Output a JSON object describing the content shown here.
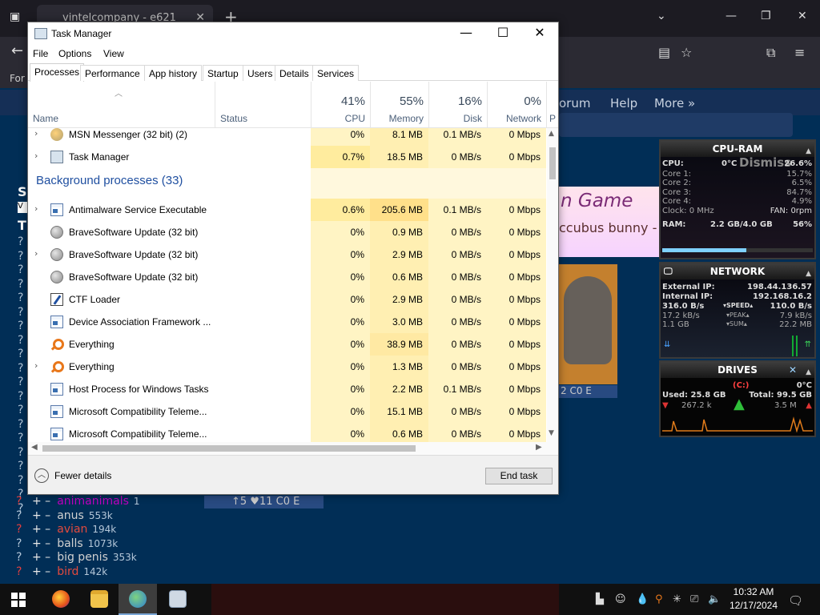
{
  "browser": {
    "tab_title": "vintelcompany - e621",
    "for_label": "For",
    "site_nav": [
      "orum",
      "Help",
      "More »"
    ],
    "game_title": "n Game",
    "game_subtitle": "ccubus bunny -",
    "post_stats": "2 C0 E",
    "post_stats2": "↑5 ♥11 C0 E",
    "left_letters": [
      "S",
      "V",
      "T",
      "?",
      "?",
      "?",
      "?",
      "?",
      "?",
      "?",
      "?",
      "?",
      "?",
      "?",
      "?",
      "?",
      "?",
      "?",
      "?",
      "?",
      "?",
      "?",
      "?"
    ],
    "tags": [
      {
        "q": "?",
        "pm": "+ –",
        "name": "animanimals",
        "count": "1",
        "color": "#c000c0"
      },
      {
        "q": "?",
        "pm": "+ –",
        "name": "anus",
        "count": "553k",
        "color": "#d0d0d0"
      },
      {
        "q": "?",
        "pm": "+ –",
        "name": "avian",
        "count": "194k",
        "color": "#e34a3d"
      },
      {
        "q": "?",
        "pm": "+ –",
        "name": "balls",
        "count": "1073k",
        "color": "#d0d0d0"
      },
      {
        "q": "?",
        "pm": "+ –",
        "name": "big penis",
        "count": "353k",
        "color": "#d0d0d0"
      },
      {
        "q": "?",
        "pm": "+ –",
        "name": "bird",
        "count": "142k",
        "color": "#e34a3d"
      }
    ]
  },
  "taskmanager": {
    "title": "Task Manager",
    "menu": [
      "File",
      "Options",
      "View"
    ],
    "tabs": [
      "Processes",
      "Performance",
      "App history",
      "Startup",
      "Users",
      "Details",
      "Services"
    ],
    "active_tab": "Processes",
    "columns": {
      "name": "Name",
      "status": "Status",
      "cpu": {
        "pct": "41%",
        "label": "CPU"
      },
      "memory": {
        "pct": "55%",
        "label": "Memory"
      },
      "disk": {
        "pct": "16%",
        "label": "Disk"
      },
      "network": {
        "pct": "0%",
        "label": "Network"
      },
      "power_partial": "P"
    },
    "rows": [
      {
        "expand": true,
        "icon": "msn-icon",
        "name": "MSN Messenger (32 bit) (2)",
        "cpu": "0%",
        "mem": "8.1 MB",
        "disk": "0.1 MB/s",
        "net": "0 Mbps"
      },
      {
        "expand": true,
        "icon": "task-manager-icon",
        "name": "Task Manager",
        "cpu": "0.7%",
        "mem": "18.5 MB",
        "disk": "0 MB/s",
        "net": "0 Mbps"
      },
      {
        "section": "Background processes (33)"
      },
      {
        "expand": true,
        "icon": "app-window-icon",
        "name": "Antimalware Service Executable",
        "cpu": "0.6%",
        "mem": "205.6 MB",
        "disk": "0.1 MB/s",
        "net": "0 Mbps"
      },
      {
        "expand": false,
        "icon": "globe-icon",
        "name": "BraveSoftware Update (32 bit)",
        "cpu": "0%",
        "mem": "0.9 MB",
        "disk": "0 MB/s",
        "net": "0 Mbps"
      },
      {
        "expand": true,
        "icon": "globe-icon",
        "name": "BraveSoftware Update (32 bit)",
        "cpu": "0%",
        "mem": "2.9 MB",
        "disk": "0 MB/s",
        "net": "0 Mbps"
      },
      {
        "expand": false,
        "icon": "globe-icon",
        "name": "BraveSoftware Update (32 bit)",
        "cpu": "0%",
        "mem": "0.6 MB",
        "disk": "0 MB/s",
        "net": "0 Mbps"
      },
      {
        "expand": false,
        "icon": "ctf-loader-icon",
        "name": "CTF Loader",
        "cpu": "0%",
        "mem": "2.9 MB",
        "disk": "0 MB/s",
        "net": "0 Mbps"
      },
      {
        "expand": false,
        "icon": "app-window-icon",
        "name": "Device Association Framework ...",
        "cpu": "0%",
        "mem": "3.0 MB",
        "disk": "0 MB/s",
        "net": "0 Mbps"
      },
      {
        "expand": false,
        "icon": "everything-search-icon",
        "name": "Everything",
        "cpu": "0%",
        "mem": "38.9 MB",
        "disk": "0 MB/s",
        "net": "0 Mbps"
      },
      {
        "expand": true,
        "icon": "everything-search-icon",
        "name": "Everything",
        "cpu": "0%",
        "mem": "1.3 MB",
        "disk": "0 MB/s",
        "net": "0 Mbps"
      },
      {
        "expand": false,
        "icon": "app-window-icon",
        "name": "Host Process for Windows Tasks",
        "cpu": "0%",
        "mem": "2.2 MB",
        "disk": "0.1 MB/s",
        "net": "0 Mbps"
      },
      {
        "expand": false,
        "icon": "app-window-icon",
        "name": "Microsoft Compatibility Teleme...",
        "cpu": "0%",
        "mem": "15.1 MB",
        "disk": "0 MB/s",
        "net": "0 Mbps"
      },
      {
        "expand": false,
        "icon": "app-window-icon",
        "name": "Microsoft Compatibility Teleme...",
        "cpu": "0%",
        "mem": "0.6 MB",
        "disk": "0 MB/s",
        "net": "0 Mbps"
      }
    ],
    "fewer_details": "Fewer details",
    "end_task": "End task"
  },
  "gadgets": {
    "cpu_ram": {
      "title": "CPU-RAM",
      "dismiss": "Dismiss",
      "cpu_label": "CPU:",
      "cpu_temp": "0°C",
      "cpu_value": "26.6%",
      "cores": [
        {
          "label": "Core 1:",
          "value": "15.7%"
        },
        {
          "label": "Core 2:",
          "value": "6.5%"
        },
        {
          "label": "Core 3:",
          "value": "84.7%"
        },
        {
          "label": "Core 4:",
          "value": "4.9%"
        }
      ],
      "clock": "Clock: 0 MHz",
      "fan": "FAN: 0rpm",
      "ram_label": "RAM:",
      "ram_used": "2.2 GB/4.0 GB",
      "ram_pct": "56%"
    },
    "network": {
      "title": "NETWORK",
      "external_label": "External IP:",
      "external_ip": "198.44.136.57",
      "internal_label": "Internal IP:",
      "internal_ip": "192.168.16.2",
      "speed_down": "316.0 B/s",
      "speed_label": "▾SPEED▴",
      "speed_up": "110.0 B/s",
      "peak_down": "17.2 kB/s",
      "peak_label": "▾PEAK▴",
      "peak_up": "7.9 kB/s",
      "sum_down": "1.1 GB",
      "sum_label": "▾SUM▴",
      "sum_up": "22.2 MB"
    },
    "drives": {
      "title": "DRIVES",
      "drive": "(C:)",
      "temp": "0°C",
      "used": "Used: 25.8 GB",
      "total": "Total: 99.5 GB",
      "read": "267.2 k",
      "write": "3.5 M"
    }
  },
  "taskbar": {
    "time": "10:32 AM",
    "date": "12/17/2024"
  }
}
